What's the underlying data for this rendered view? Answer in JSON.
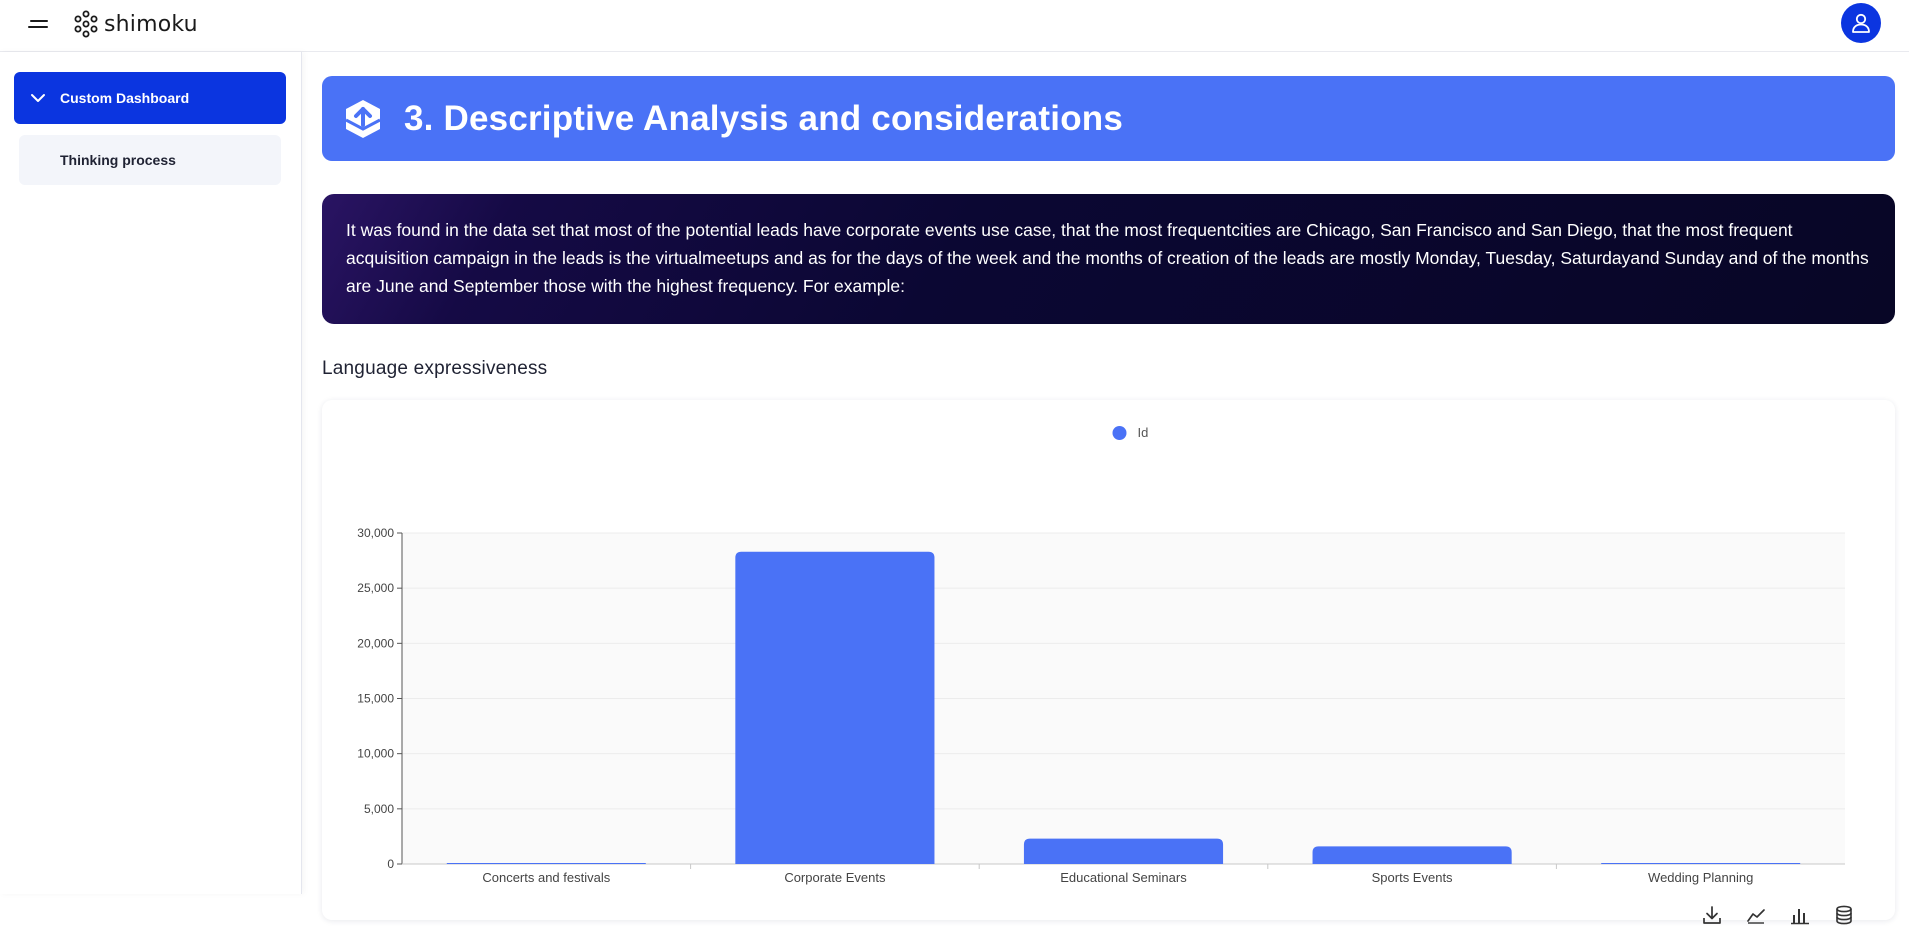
{
  "app": {
    "logo_text": "shimoku"
  },
  "sidebar": {
    "parent_label": "Custom Dashboard",
    "child_label": "Thinking process"
  },
  "header": {
    "title": "3. Descriptive Analysis and considerations"
  },
  "description": {
    "text": "It was found in the data set that most of the potential leads have corporate events use case, that the most frequentcities are Chicago, San Francisco and San Diego, that the most frequent acquisition campaign in the leads is the virtualmeetups and as for the days of the week and the months of creation of the leads are mostly Monday, Tuesday, Saturdayand Sunday and of the months are June and September those with the highest frequency. For example:"
  },
  "section": {
    "title": "Language expressiveness"
  },
  "colors": {
    "brand": "#0b35e0",
    "header": "#4a72f6",
    "bar": "#4a72f6"
  },
  "chart_data": {
    "type": "bar",
    "categories": [
      "Concerts and festivals",
      "Corporate Events",
      "Educational Seminars",
      "Sports Events",
      "Wedding Planning"
    ],
    "series": [
      {
        "name": "Id",
        "values": [
          60,
          28300,
          2300,
          1600,
          40
        ]
      }
    ],
    "ylim": [
      0,
      30000
    ],
    "yticks": [
      0,
      5000,
      10000,
      15000,
      20000,
      25000,
      30000
    ],
    "ytick_labels": [
      "0",
      "5,000",
      "10,000",
      "15,000",
      "20,000",
      "25,000",
      "30,000"
    ],
    "legend_position": "top-center",
    "grid": true
  },
  "toolbar": {
    "icons": [
      "download-icon",
      "line-chart-icon",
      "bar-chart-icon",
      "database-icon"
    ]
  }
}
